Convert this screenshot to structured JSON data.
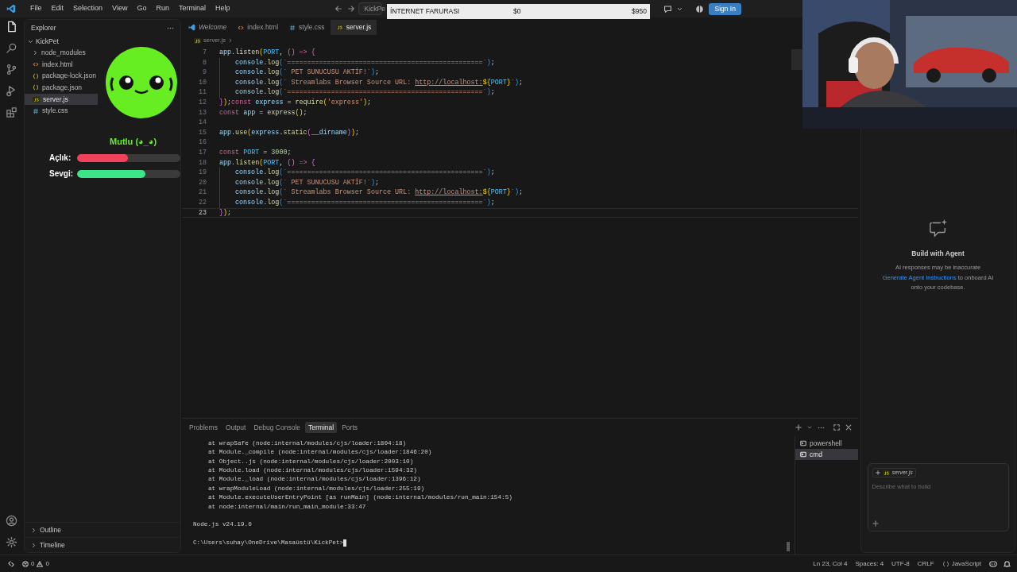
{
  "title_bar": {
    "menu": [
      "File",
      "Edit",
      "Selection",
      "View",
      "Go",
      "Run",
      "Terminal",
      "Help"
    ],
    "search_text": "KickPe",
    "sign_in": "Sign In"
  },
  "stream_banner": {
    "title": "İNTERNET FARURASI",
    "current": "$0",
    "goal": "$950"
  },
  "activity_bar": [
    {
      "selected": true
    },
    {
      "selected": false
    },
    {
      "selected": false
    },
    {
      "selected": false
    },
    {
      "selected": false
    }
  ],
  "explorer": {
    "title": "Explorer",
    "folder": "KickPet",
    "expanded": true,
    "items": [
      {
        "label": "node_modules",
        "kind": "folder",
        "selected": false
      },
      {
        "label": "index.html",
        "kind": "html",
        "selected": false
      },
      {
        "label": "package-lock.json",
        "kind": "json",
        "selected": false
      },
      {
        "label": "package.json",
        "kind": "json",
        "selected": false
      },
      {
        "label": "server.js",
        "kind": "js",
        "selected": true
      },
      {
        "label": "style.css",
        "kind": "css",
        "selected": false
      }
    ],
    "sections": [
      "Outline",
      "Timeline"
    ]
  },
  "editor": {
    "tabs": [
      {
        "label": "Welcome",
        "kind": "welcome",
        "selected": false
      },
      {
        "label": "index.html",
        "kind": "html",
        "selected": false
      },
      {
        "label": "style.css",
        "kind": "css",
        "selected": false
      },
      {
        "label": "server.js",
        "kind": "js",
        "selected": true
      }
    ],
    "breadcrumb": "server.js",
    "lines": [
      {
        "n": "7",
        "current": false,
        "indented": false,
        "tokens": [
          {
            "kind": "var",
            "text": "app"
          },
          {
            "kind": "p",
            "text": "."
          },
          {
            "kind": "fn",
            "text": "listen"
          },
          {
            "kind": "b1",
            "text": "("
          },
          {
            "kind": "c",
            "text": "PORT"
          },
          {
            "kind": "p",
            "text": ", "
          },
          {
            "kind": "b2",
            "text": "()"
          },
          {
            "kind": "kw",
            "text": " => "
          },
          {
            "kind": "b2",
            "text": "{"
          }
        ]
      },
      {
        "n": "8",
        "current": false,
        "indented": true,
        "tokens": [
          {
            "kind": "var",
            "text": "console"
          },
          {
            "kind": "p",
            "text": "."
          },
          {
            "kind": "fn",
            "text": "log"
          },
          {
            "kind": "b3",
            "text": "("
          },
          {
            "kind": "str",
            "text": "`=================================================`"
          },
          {
            "kind": "b3",
            "text": ")"
          },
          {
            "kind": "p",
            "text": ";"
          }
        ]
      },
      {
        "n": "9",
        "current": false,
        "indented": true,
        "tokens": [
          {
            "kind": "var",
            "text": "console"
          },
          {
            "kind": "p",
            "text": "."
          },
          {
            "kind": "fn",
            "text": "log"
          },
          {
            "kind": "b3",
            "text": "("
          },
          {
            "kind": "str",
            "text": "` PET SUNUCUSU AKTİF!`"
          },
          {
            "kind": "b3",
            "text": ")"
          },
          {
            "kind": "p",
            "text": ";"
          }
        ]
      },
      {
        "n": "10",
        "current": false,
        "indented": true,
        "tokens": [
          {
            "kind": "var",
            "text": "console"
          },
          {
            "kind": "p",
            "text": "."
          },
          {
            "kind": "fn",
            "text": "log"
          },
          {
            "kind": "b3",
            "text": "("
          },
          {
            "kind": "str",
            "text": "` Streamlabs Browser Source URL: "
          },
          {
            "kind": "link",
            "text": "http://localhost:"
          },
          {
            "kind": "b1",
            "text": "${"
          },
          {
            "kind": "c",
            "text": "PORT"
          },
          {
            "kind": "b1",
            "text": "}"
          },
          {
            "kind": "str",
            "text": "`"
          },
          {
            "kind": "b3",
            "text": ")"
          },
          {
            "kind": "p",
            "text": ";"
          }
        ]
      },
      {
        "n": "11",
        "current": false,
        "indented": true,
        "tokens": [
          {
            "kind": "var",
            "text": "console"
          },
          {
            "kind": "p",
            "text": "."
          },
          {
            "kind": "fn",
            "text": "log"
          },
          {
            "kind": "b3",
            "text": "("
          },
          {
            "kind": "str",
            "text": "`=================================================`"
          },
          {
            "kind": "b3",
            "text": ")"
          },
          {
            "kind": "p",
            "text": ";"
          }
        ]
      },
      {
        "n": "12",
        "current": false,
        "indented": false,
        "tokens": [
          {
            "kind": "b2",
            "text": "}"
          },
          {
            "kind": "b1",
            "text": ")"
          },
          {
            "kind": "p",
            "text": ";"
          },
          {
            "kind": "kw",
            "text": "const "
          },
          {
            "kind": "var",
            "text": "express"
          },
          {
            "kind": "p",
            "text": " = "
          },
          {
            "kind": "fn",
            "text": "require"
          },
          {
            "kind": "b1",
            "text": "("
          },
          {
            "kind": "str",
            "text": "'express'"
          },
          {
            "kind": "b1",
            "text": ")"
          },
          {
            "kind": "p",
            "text": ";"
          }
        ]
      },
      {
        "n": "13",
        "current": false,
        "indented": false,
        "tokens": [
          {
            "kind": "kw",
            "text": "const "
          },
          {
            "kind": "var",
            "text": "app"
          },
          {
            "kind": "p",
            "text": " = "
          },
          {
            "kind": "fn",
            "text": "express"
          },
          {
            "kind": "b1",
            "text": "()"
          },
          {
            "kind": "p",
            "text": ";"
          }
        ]
      },
      {
        "n": "14",
        "current": false
      },
      {
        "n": "15",
        "current": false,
        "indented": false,
        "tokens": [
          {
            "kind": "var",
            "text": "app"
          },
          {
            "kind": "p",
            "text": "."
          },
          {
            "kind": "fn",
            "text": "use"
          },
          {
            "kind": "b1",
            "text": "("
          },
          {
            "kind": "var",
            "text": "express"
          },
          {
            "kind": "p",
            "text": "."
          },
          {
            "kind": "fn",
            "text": "static"
          },
          {
            "kind": "b2",
            "text": "("
          },
          {
            "kind": "var",
            "text": "__dirname"
          },
          {
            "kind": "b2",
            "text": ")"
          },
          {
            "kind": "b1",
            "text": ")"
          },
          {
            "kind": "p",
            "text": ";"
          }
        ]
      },
      {
        "n": "16",
        "current": false
      },
      {
        "n": "17",
        "current": false,
        "indented": false,
        "tokens": [
          {
            "kind": "kw",
            "text": "const "
          },
          {
            "kind": "c",
            "text": "PORT"
          },
          {
            "kind": "p",
            "text": " = "
          },
          {
            "kind": "num",
            "text": "3000"
          },
          {
            "kind": "p",
            "text": ";"
          }
        ]
      },
      {
        "n": "18",
        "current": false,
        "indented": false,
        "tokens": [
          {
            "kind": "var",
            "text": "app"
          },
          {
            "kind": "p",
            "text": "."
          },
          {
            "kind": "fn",
            "text": "listen"
          },
          {
            "kind": "b1",
            "text": "("
          },
          {
            "kind": "c",
            "text": "PORT"
          },
          {
            "kind": "p",
            "text": ", "
          },
          {
            "kind": "b2",
            "text": "()"
          },
          {
            "kind": "kw",
            "text": " => "
          },
          {
            "kind": "b2",
            "text": "{"
          }
        ]
      },
      {
        "n": "19",
        "current": false,
        "indented": true,
        "tokens": [
          {
            "kind": "var",
            "text": "console"
          },
          {
            "kind": "p",
            "text": "."
          },
          {
            "kind": "fn",
            "text": "log"
          },
          {
            "kind": "b3",
            "text": "("
          },
          {
            "kind": "str",
            "text": "`=================================================`"
          },
          {
            "kind": "b3",
            "text": ")"
          },
          {
            "kind": "p",
            "text": ";"
          }
        ]
      },
      {
        "n": "20",
        "current": false,
        "indented": true,
        "tokens": [
          {
            "kind": "var",
            "text": "console"
          },
          {
            "kind": "p",
            "text": "."
          },
          {
            "kind": "fn",
            "text": "log"
          },
          {
            "kind": "b3",
            "text": "("
          },
          {
            "kind": "str",
            "text": "` PET SUNUCUSU AKTİF!`"
          },
          {
            "kind": "b3",
            "text": ")"
          },
          {
            "kind": "p",
            "text": ";"
          }
        ]
      },
      {
        "n": "21",
        "current": false,
        "indented": true,
        "tokens": [
          {
            "kind": "var",
            "text": "console"
          },
          {
            "kind": "p",
            "text": "."
          },
          {
            "kind": "fn",
            "text": "log"
          },
          {
            "kind": "b3",
            "text": "("
          },
          {
            "kind": "str",
            "text": "` Streamlabs Browser Source URL: "
          },
          {
            "kind": "link",
            "text": "http://localhost:"
          },
          {
            "kind": "b1",
            "text": "${"
          },
          {
            "kind": "c",
            "text": "PORT"
          },
          {
            "kind": "b1",
            "text": "}"
          },
          {
            "kind": "str",
            "text": "`"
          },
          {
            "kind": "b3",
            "text": ")"
          },
          {
            "kind": "p",
            "text": ";"
          }
        ]
      },
      {
        "n": "22",
        "current": false,
        "indented": true,
        "tokens": [
          {
            "kind": "var",
            "text": "console"
          },
          {
            "kind": "p",
            "text": "."
          },
          {
            "kind": "fn",
            "text": "log"
          },
          {
            "kind": "b3",
            "text": "("
          },
          {
            "kind": "str",
            "text": "`=================================================`"
          },
          {
            "kind": "b3",
            "text": ")"
          },
          {
            "kind": "p",
            "text": ";"
          }
        ]
      },
      {
        "n": "23",
        "current": true,
        "indented": false,
        "tokens": [
          {
            "kind": "b2",
            "text": "}"
          },
          {
            "kind": "b1",
            "text": ")"
          },
          {
            "kind": "p",
            "text": ";"
          }
        ]
      }
    ]
  },
  "pet_overlay": {
    "mood": "Mutlu (◕_◕)",
    "stats": [
      {
        "label": "Açlık:",
        "level": 0.49,
        "color": "#f0435b"
      },
      {
        "label": "Sevgi:",
        "level": 0.66,
        "color": "#3ee488"
      }
    ]
  },
  "panel": {
    "tabs": [
      {
        "label": "Problems",
        "selected": false
      },
      {
        "label": "Output",
        "selected": false
      },
      {
        "label": "Debug Console",
        "selected": false
      },
      {
        "label": "Terminal",
        "selected": true
      },
      {
        "label": "Ports",
        "selected": false
      }
    ],
    "stack_lines": [
      "at wrapSafe (node:internal/modules/cjs/loader:1804:18)",
      "at Module._compile (node:internal/modules/cjs/loader:1846:20)",
      "at Object..js (node:internal/modules/cjs/loader:2003:10)",
      "at Module.load (node:internal/modules/cjs/loader:1594:32)",
      "at Module._load (node:internal/modules/cjs/loader:1396:12)",
      "at wrapModuleLoad (node:internal/modules/cjs/loader:255:19)",
      "at Module.executeUserEntryPoint [as runMain] (node:internal/modules/run_main:154:5)",
      "at node:internal/main/run_main_module:33:47"
    ],
    "node_version": "Node.js v24.19.0",
    "prompt": "C:\\Users\\suhay\\OneDrive\\Masaüstü\\KickPet>",
    "terminals": [
      {
        "label": "powershell",
        "selected": false
      },
      {
        "label": "cmd",
        "selected": true
      }
    ]
  },
  "chat": {
    "title": "Build with Agent",
    "note": "AI responses may be inaccurate",
    "link": "Generate Agent Instructions",
    "after_link": " to onboard AI onto your codebase.",
    "context_file": "server.js",
    "placeholder": "Describe what to build"
  },
  "status_bar": {
    "errors": "0",
    "warnings": "0",
    "items": [
      "Ln 23, Col 4",
      "Spaces: 4",
      "UTF-8",
      "CRLF"
    ],
    "language": "JavaScript"
  }
}
